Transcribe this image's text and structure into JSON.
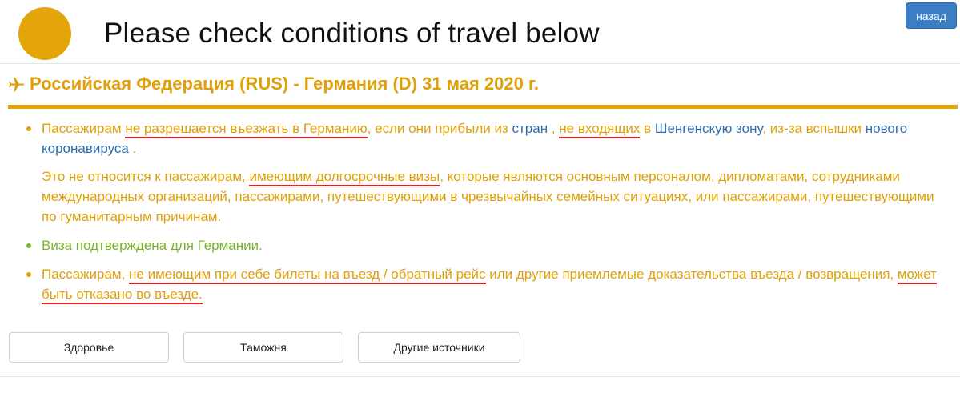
{
  "header": {
    "title": "Please check conditions of travel below",
    "back_label": "назад",
    "logo_color": "#e3a50a"
  },
  "route": {
    "icon": "airplane-icon",
    "text": "Российская Федерация (RUS) - Германия (D) 31 мая 2020 г."
  },
  "conditions": [
    {
      "parts": [
        {
          "text": "Пассажирам "
        },
        {
          "text": "не разрешается въезжать в Германию",
          "style": "underline"
        },
        {
          "text": ", если они прибыли из "
        },
        {
          "text": "стран",
          "style": "link"
        },
        {
          "text": " , "
        },
        {
          "text": "не входящих",
          "style": "underline"
        },
        {
          "text": " в "
        },
        {
          "text": "Шенгенскую зону",
          "style": "link"
        },
        {
          "text": ",  из-за вспышки  "
        },
        {
          "text": "нового коронавируса",
          "style": "link"
        },
        {
          "text": " ."
        }
      ],
      "note_parts": [
        {
          "text": "Это не относится к пассажирам, "
        },
        {
          "text": "имеющим долгосрочные визы",
          "style": "underline"
        },
        {
          "text": ", которые являются основным персоналом, дипломатами, сотрудниками международных организаций, пассажирами, путешествующими в чрезвычайных семейных ситуациях, или пассажирами, путешествующими по гуманитарным причинам."
        }
      ]
    },
    {
      "text": "Виза подтверждена для Германии."
    },
    {
      "parts": [
        {
          "text": "Пассажирам, "
        },
        {
          "text": "не имеющим при себе билеты на въезд / обратный рейс",
          "style": "underline"
        },
        {
          "text": " или другие приемлемые доказательства въезда / возвращения, "
        },
        {
          "text": "может быть отказано во въезде.",
          "style": "underline"
        }
      ]
    }
  ],
  "buttons": {
    "health": "Здоровье",
    "customs": "Таможня",
    "other_sources": "Другие источники"
  },
  "colors": {
    "accent": "#e0a008",
    "bar": "#e3a50a",
    "link": "#2f6fb0",
    "ok": "#78b42a",
    "underline": "#e81e1e",
    "back_button": "#3c7ec4"
  }
}
